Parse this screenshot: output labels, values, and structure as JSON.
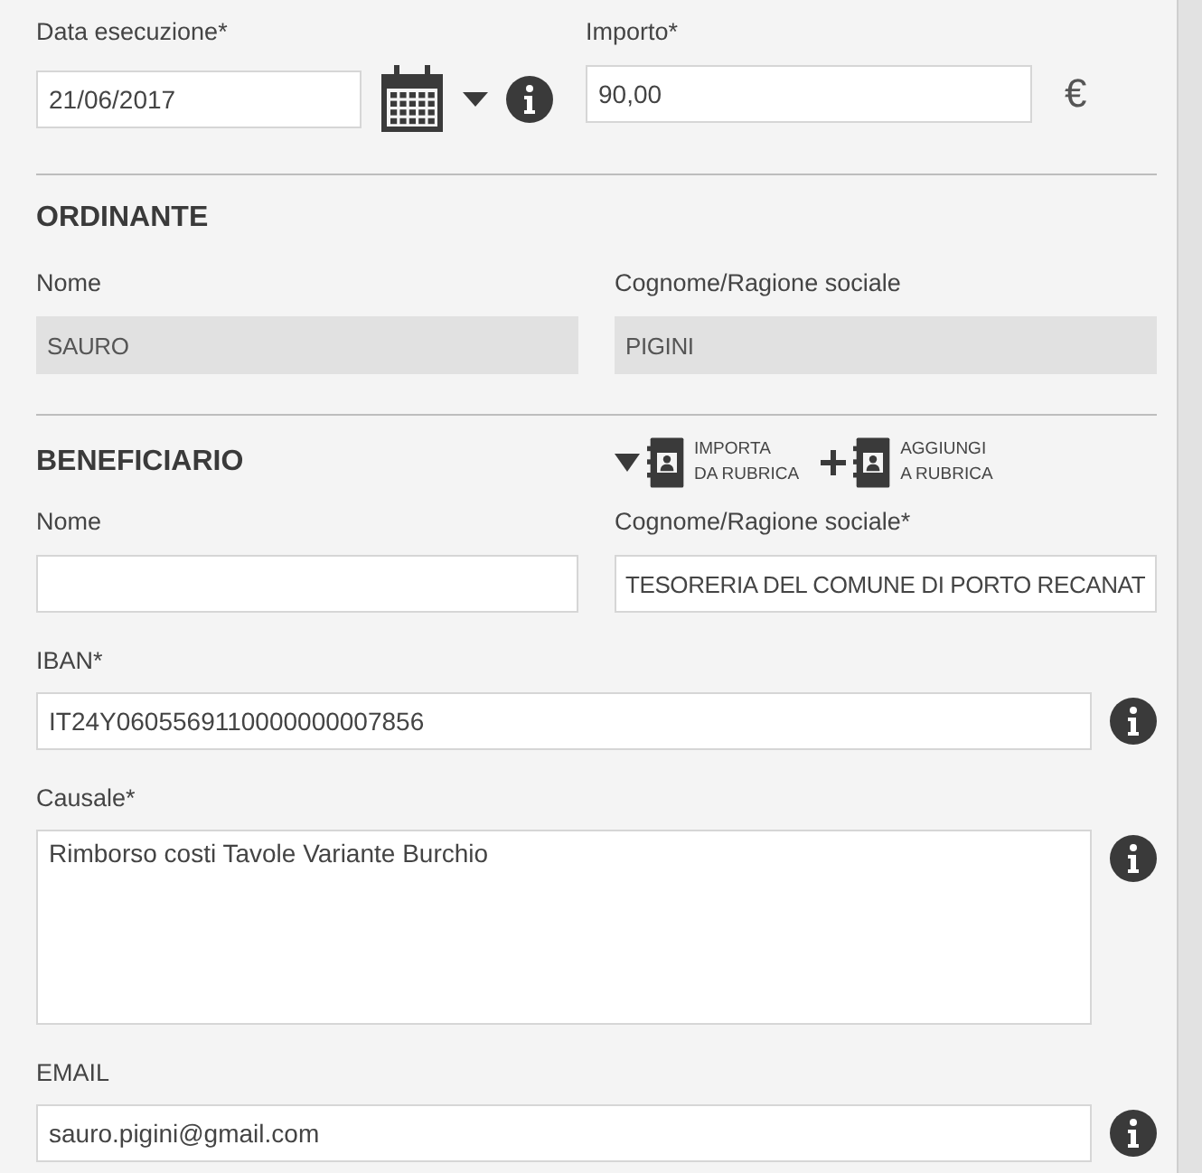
{
  "top_row": {
    "date": {
      "label": "Data esecuzione*",
      "value": "21/06/2017"
    },
    "amount": {
      "label": "Importo*",
      "value": "90,00",
      "currency": "€"
    }
  },
  "ordinante": {
    "title": "ORDINANTE",
    "fields": [
      {
        "label": "Nome",
        "value": "SAURO",
        "disabled": true
      },
      {
        "label": "Cognome/Ragione sociale",
        "value": "PIGINI",
        "disabled": true
      }
    ]
  },
  "beneficiario": {
    "title": "BENEFICIARIO",
    "actions": [
      {
        "kind": "import",
        "label_lines": [
          "IMPORTA",
          "DA RUBRICA"
        ]
      },
      {
        "kind": "add",
        "label_lines": [
          "AGGIUNGI",
          "A RUBRICA"
        ]
      }
    ],
    "fields": [
      {
        "label": "Nome",
        "disabled": false
      },
      {
        "label": "Cognome/Ragione sociale*",
        "value": "TESORERIA DEL COMUNE DI PORTO RECANAT",
        "disabled": false
      }
    ]
  },
  "wide_fields": [
    {
      "kind": "input",
      "label": "IBAN*",
      "value": "IT24Y0605569110000000007856"
    },
    {
      "kind": "textarea",
      "label": "Causale*",
      "value": "Rimborso costi Tavole Variante Burchio"
    },
    {
      "kind": "input",
      "label": "EMAIL",
      "value": "sauro.pigini@gmail.com"
    }
  ]
}
